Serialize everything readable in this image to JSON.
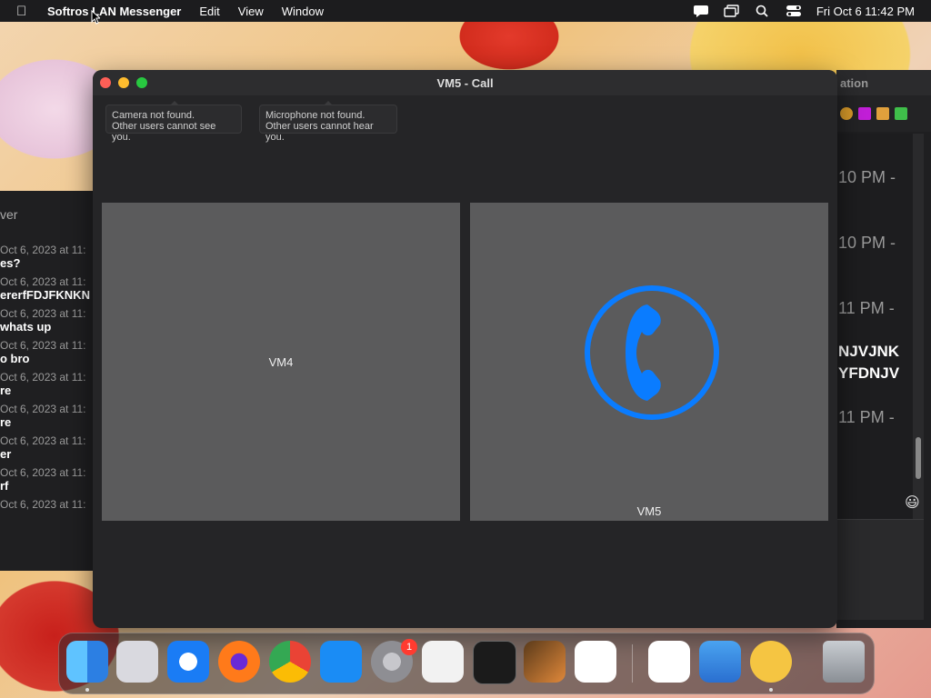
{
  "menubar": {
    "app_name": "Softros LAN Messenger",
    "menus": [
      "Edit",
      "View",
      "Window"
    ],
    "clock": "Fri Oct 6  11:42 PM"
  },
  "call_window": {
    "title": "VM5 - Call",
    "camera_notice": {
      "line1": "Camera not found.",
      "line2": "Other users cannot see you."
    },
    "microphone_notice": {
      "line1": "Microphone not found.",
      "line2": "Other users cannot hear you."
    },
    "local_tile_label": "VM4",
    "remote_tile_label": "VM5",
    "accent_color": "#0a7cff"
  },
  "left_window": {
    "header": "ver",
    "messages": [
      {
        "date": "Oct 6, 2023 at 11:",
        "text": "es?"
      },
      {
        "date": "Oct 6, 2023 at 11:",
        "text": "ererfFDJFKNKN"
      },
      {
        "date": "Oct 6, 2023 at 11:",
        "text": "whats up"
      },
      {
        "date": "Oct 6, 2023 at 11:",
        "text": "o bro"
      },
      {
        "date": "Oct 6, 2023 at 11:",
        "text": "re"
      },
      {
        "date": "Oct 6, 2023 at 11:",
        "text": "re"
      },
      {
        "date": "Oct 6, 2023 at 11:",
        "text": "er"
      },
      {
        "date": "Oct 6, 2023 at 11:",
        "text": "rf"
      },
      {
        "date": "Oct 6, 2023 at 11:",
        "text": ""
      }
    ]
  },
  "right_window": {
    "title": "ation",
    "times": [
      "10 PM -",
      "10 PM -",
      "11 PM -",
      "11 PM -"
    ],
    "texts": [
      "NJVJNK",
      "YFDNJV"
    ]
  },
  "dock": {
    "apps": [
      {
        "name": "Finder",
        "color": "#2f8cf0"
      },
      {
        "name": "Launchpad",
        "color": "#d9d9df"
      },
      {
        "name": "Safari",
        "color": "#1a7cf5"
      },
      {
        "name": "Firefox",
        "color": "#ff7a1a"
      },
      {
        "name": "Chrome",
        "color": "#ffffff"
      },
      {
        "name": "App Store",
        "color": "#1a8cf5"
      },
      {
        "name": "System Settings",
        "color": "#8e8e93"
      },
      {
        "name": "TextEdit",
        "color": "#f2f2f2"
      },
      {
        "name": "Terminal",
        "color": "#1b1b1b"
      },
      {
        "name": "GarageBand",
        "color": "#3a2a1a"
      },
      {
        "name": "Visual Studio Code",
        "color": "#1e6fcf"
      },
      {
        "name": "Visual Studio",
        "color": "#ffffff"
      },
      {
        "name": "Weather",
        "color": "#3b8fe0"
      },
      {
        "name": "Softros LAN Messenger",
        "color": "#f5c542"
      },
      {
        "name": "Trash",
        "color": "#9ea3a8"
      }
    ],
    "settings_badge": "1"
  }
}
